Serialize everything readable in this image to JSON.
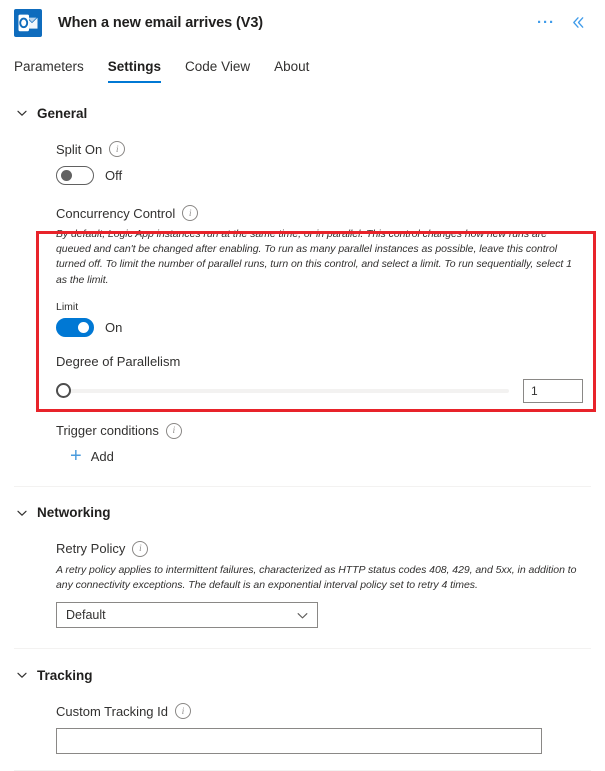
{
  "header": {
    "title": "When a new email arrives (V3)",
    "app_icon": "outlook-icon",
    "more_label": "···",
    "collapse_label": "«"
  },
  "tabs": [
    {
      "label": "Parameters",
      "active": false
    },
    {
      "label": "Settings",
      "active": true
    },
    {
      "label": "Code View",
      "active": false
    },
    {
      "label": "About",
      "active": false
    }
  ],
  "sections": {
    "general": {
      "title": "General",
      "split_on": {
        "label": "Split On",
        "state_text": "Off",
        "enabled": false
      },
      "concurrency": {
        "label": "Concurrency Control",
        "description": "By default, Logic App instances run at the same time, or in parallel. This control changes how new runs are queued and can't be changed after enabling. To run as many parallel instances as possible, leave this control turned off. To limit the number of parallel runs, turn on this control, and select a limit. To run sequentially, select 1 as the limit.",
        "limit_label": "Limit",
        "limit_state_text": "On",
        "limit_enabled": true,
        "parallelism_label": "Degree of Parallelism",
        "parallelism_value": "1"
      },
      "trigger_conditions": {
        "label": "Trigger conditions",
        "add_label": "Add"
      }
    },
    "networking": {
      "title": "Networking",
      "retry_policy": {
        "label": "Retry Policy",
        "description": "A retry policy applies to intermittent failures, characterized as HTTP status codes 408, 429, and 5xx, in addition to any connectivity exceptions. The default is an exponential interval policy set to retry 4 times.",
        "selected": "Default"
      }
    },
    "tracking": {
      "title": "Tracking",
      "custom_tracking_id": {
        "label": "Custom Tracking Id",
        "value": "",
        "placeholder": ""
      }
    }
  },
  "colors": {
    "accent": "#0078d4",
    "highlight": "#e8232a",
    "app_icon_bg": "#0f6cbd"
  }
}
